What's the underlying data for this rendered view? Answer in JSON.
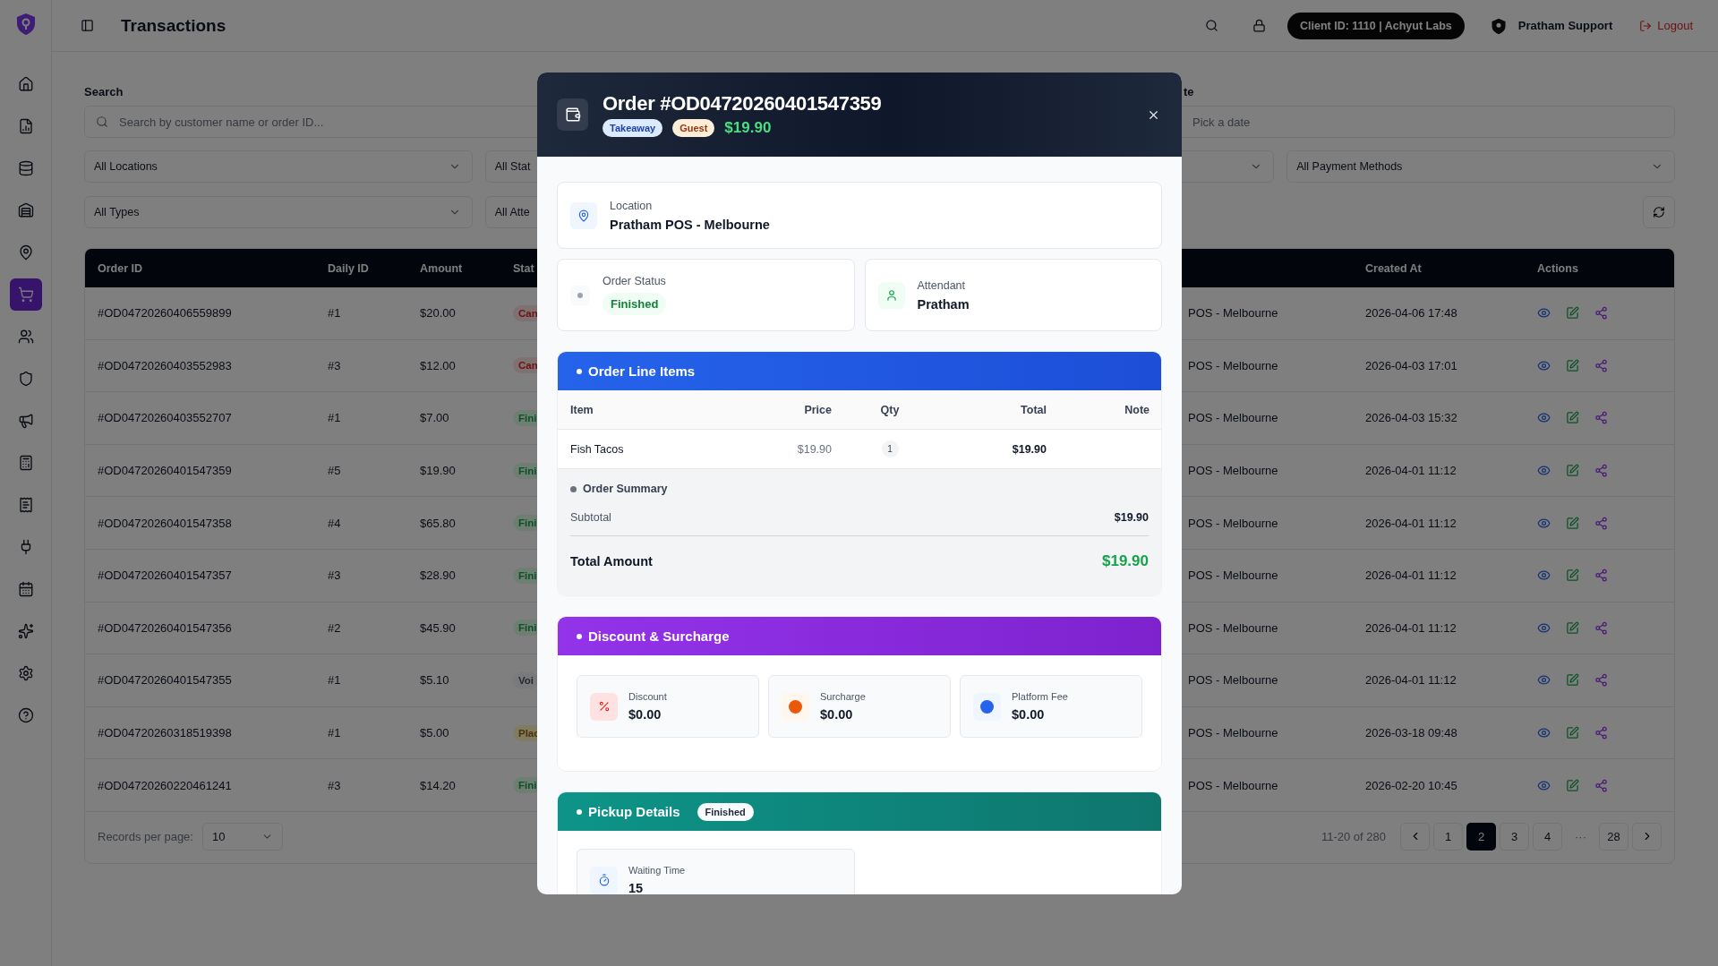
{
  "sidebar": {
    "items": [
      {
        "selected": false
      },
      {
        "selected": false
      },
      {
        "selected": false
      },
      {
        "selected": false
      },
      {
        "selected": false
      },
      {
        "selected": true
      },
      {
        "selected": false
      },
      {
        "selected": false
      },
      {
        "selected": false
      },
      {
        "selected": false
      },
      {
        "selected": false
      },
      {
        "selected": false
      },
      {
        "selected": false
      },
      {
        "selected": false
      },
      {
        "selected": false
      },
      {
        "selected": false
      }
    ]
  },
  "header": {
    "title": "Transactions",
    "client": "Client ID: 1110 | Achyut Labs",
    "user": "Pratham Support",
    "logout": "Logout"
  },
  "filters": {
    "search_label": "Search",
    "search_placeholder": "Search by customer name or order ID...",
    "date_label": "te",
    "date_placeholder": "Pick a date",
    "row_1": [
      {
        "value": "All Locations"
      },
      {
        "value": "All Stat"
      },
      {
        "value": "All Payment Methods"
      }
    ],
    "row_2": [
      {
        "value": "All Types"
      },
      {
        "value": "All Atte"
      }
    ]
  },
  "table": {
    "columns": [
      "Order ID",
      "Daily ID",
      "Amount",
      "Stat",
      "",
      "Created At",
      "Actions"
    ],
    "rows": [
      {
        "order_id": "#OD04720260406559899",
        "daily_id": "#1",
        "amount": "$20.00",
        "status": {
          "text": "Can",
          "kind": "cancelled"
        },
        "location": "POS - Melbourne",
        "created_at": "2026-04-06 17:48"
      },
      {
        "order_id": "#OD04720260403552983",
        "daily_id": "#3",
        "amount": "$12.00",
        "status": {
          "text": "Can",
          "kind": "cancelled"
        },
        "location": "POS - Melbourne",
        "created_at": "2026-04-03 17:01"
      },
      {
        "order_id": "#OD04720260403552707",
        "daily_id": "#1",
        "amount": "$7.00",
        "status": {
          "text": "Fini",
          "kind": "finished"
        },
        "location": "POS - Melbourne",
        "created_at": "2026-04-03 15:32"
      },
      {
        "order_id": "#OD04720260401547359",
        "daily_id": "#5",
        "amount": "$19.90",
        "status": {
          "text": "Fini",
          "kind": "finished"
        },
        "location": "POS - Melbourne",
        "created_at": "2026-04-01 11:12"
      },
      {
        "order_id": "#OD04720260401547358",
        "daily_id": "#4",
        "amount": "$65.80",
        "status": {
          "text": "Fini",
          "kind": "finished"
        },
        "location": "POS - Melbourne",
        "created_at": "2026-04-01 11:12"
      },
      {
        "order_id": "#OD04720260401547357",
        "daily_id": "#3",
        "amount": "$28.90",
        "status": {
          "text": "Fini",
          "kind": "finished"
        },
        "location": "POS - Melbourne",
        "created_at": "2026-04-01 11:12"
      },
      {
        "order_id": "#OD04720260401547356",
        "daily_id": "#2",
        "amount": "$45.90",
        "status": {
          "text": "Fini",
          "kind": "finished"
        },
        "location": "POS - Melbourne",
        "created_at": "2026-04-01 11:12"
      },
      {
        "order_id": "#OD04720260401547355",
        "daily_id": "#1",
        "amount": "$5.10",
        "status": {
          "text": "Voi",
          "kind": "void"
        },
        "location": "POS - Melbourne",
        "created_at": "2026-04-01 11:12"
      },
      {
        "order_id": "#OD04720260318519398",
        "daily_id": "#1",
        "amount": "$5.00",
        "status": {
          "text": "Plac",
          "kind": "placed"
        },
        "location": "POS - Melbourne",
        "created_at": "2026-03-18 09:48"
      },
      {
        "order_id": "#OD04720260220461241",
        "daily_id": "#3",
        "amount": "$14.20",
        "status": {
          "text": "Fini",
          "kind": "finished"
        },
        "location": "POS - Melbourne",
        "created_at": "2026-02-20 10:45"
      }
    ]
  },
  "pagination": {
    "records_label": "Records per page:",
    "per_page": "10",
    "range": "11-20 of 280",
    "pages": [
      {
        "label": "1",
        "kind": "page",
        "selected": false
      },
      {
        "label": "2",
        "kind": "page",
        "selected": true
      },
      {
        "label": "3",
        "kind": "page",
        "selected": false
      },
      {
        "label": "4",
        "kind": "page",
        "selected": false
      },
      {
        "label": "···",
        "kind": "ellipsis"
      },
      {
        "label": "28",
        "kind": "page",
        "selected": false
      }
    ]
  },
  "modal": {
    "title": "Order #OD04720260401547359",
    "badges": [
      {
        "text": "Takeaway",
        "kind": "type"
      },
      {
        "text": "Guest",
        "kind": "customer"
      }
    ],
    "amount": "$19.90",
    "location": {
      "label": "Location",
      "value": "Pratham POS - Melbourne"
    },
    "status": {
      "label": "Order Status",
      "value": "Finished"
    },
    "attendant": {
      "label": "Attendant",
      "value": "Pratham"
    },
    "line_items": {
      "title": "Order Line Items",
      "columns": [
        "Item",
        "Price",
        "Qty",
        "Total",
        "Note"
      ],
      "rows": [
        {
          "item": "Fish Tacos",
          "price": "$19.90",
          "qty": "1",
          "total": "$19.90"
        }
      ],
      "summary": {
        "title": "Order Summary",
        "subtotal_label": "Subtotal",
        "subtotal": "$19.90",
        "total_label": "Total Amount",
        "total": "$19.90"
      }
    },
    "discount": {
      "title": "Discount & Surcharge",
      "cards": [
        {
          "kind": "discount",
          "label": "Discount",
          "value": "$0.00"
        },
        {
          "kind": "surcharge",
          "label": "Surcharge",
          "value": "$0.00"
        },
        {
          "kind": "platform_fee",
          "label": "Platform Fee",
          "value": "$0.00"
        }
      ]
    },
    "pickup": {
      "title": "Pickup Details",
      "status": "Finished",
      "cards": [
        {
          "label": "Waiting Time",
          "value": "15"
        }
      ]
    }
  }
}
